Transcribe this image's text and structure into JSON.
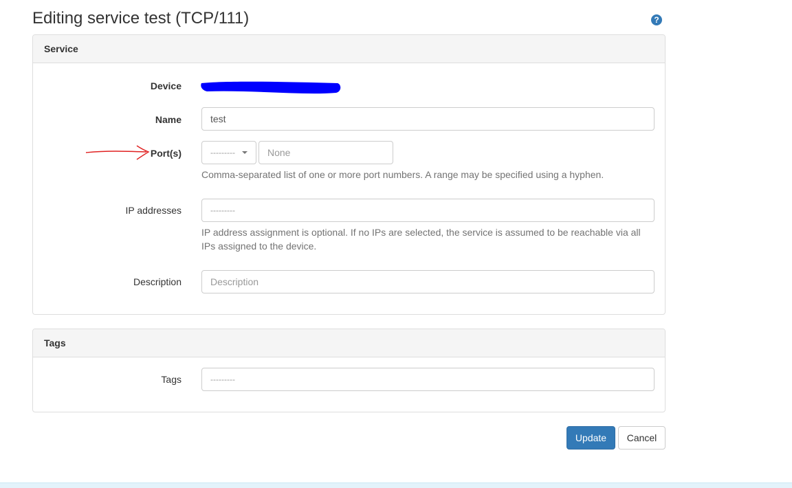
{
  "page": {
    "title": "Editing service test (TCP/111)",
    "help_icon": "question-circle-icon"
  },
  "service_panel": {
    "heading": "Service",
    "device": {
      "label": "Device"
    },
    "name": {
      "label": "Name",
      "value": "test"
    },
    "ports": {
      "label": "Port(s)",
      "protocol_selected": "---------",
      "placeholder": "None",
      "help": "Comma-separated list of one or more port numbers. A range may be specified using a hyphen."
    },
    "ip_addresses": {
      "label": "IP addresses",
      "selected": "---------",
      "help_line1": "IP address assignment is optional. If no IPs are selected, the service is assumed to be reachable via all",
      "help_line2": "IPs assigned to the device."
    },
    "description": {
      "label": "Description",
      "placeholder": "Description"
    }
  },
  "tags_panel": {
    "heading": "Tags",
    "tags": {
      "label": "Tags",
      "selected": "---------"
    }
  },
  "actions": {
    "update_label": "Update",
    "cancel_label": "Cancel"
  },
  "colors": {
    "primary": "#337ab7",
    "redaction": "#0000ff",
    "annotation": "#e02020"
  }
}
